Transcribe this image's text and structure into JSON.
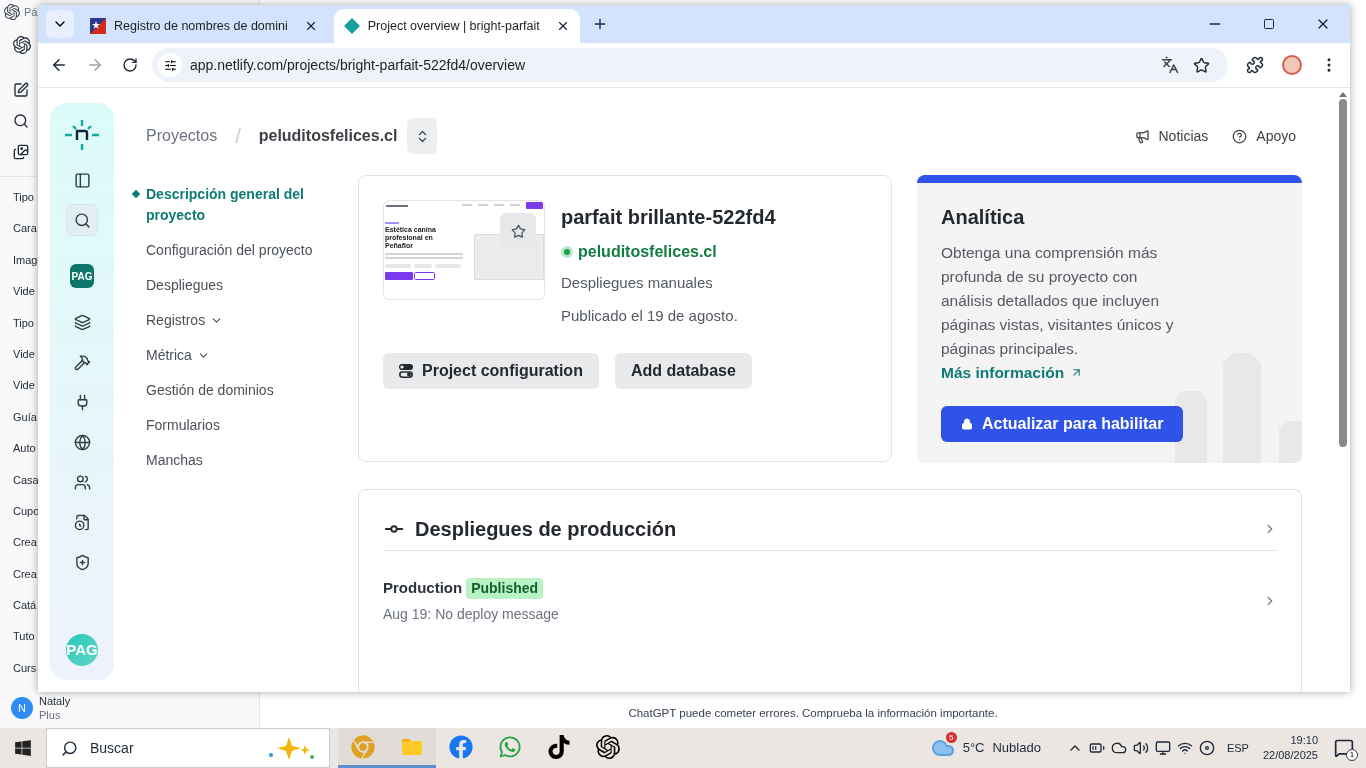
{
  "background_app": {
    "title_fragment": "Pá",
    "chats": [
      "Tipo",
      "Cara",
      "Imag",
      "Vide",
      "Tipo",
      "Vide",
      "Vide",
      "Guía",
      "Auto",
      "Casa",
      "Cupo",
      "Crea",
      "Crea",
      "Catá",
      "Tuto",
      "Curs"
    ],
    "user": {
      "initial": "N",
      "name": "Nataly",
      "plan": "Plus"
    },
    "disclaimer": "ChatGPT puede cometer errores. Comprueba la información importante."
  },
  "browser": {
    "tabs": [
      {
        "title": "Registro de nombres de domini",
        "selected": false,
        "kind": "flag"
      },
      {
        "title": "Project overview | bright-parfait",
        "selected": true,
        "kind": "diamond"
      }
    ],
    "url": "app.netlify.com/projects/bright-parfait-522fd4/overview"
  },
  "netlify": {
    "rail": [
      {
        "kind": "sidebar",
        "selected": false
      },
      {
        "kind": "search",
        "selected": true
      },
      {
        "kind": "team",
        "label": "PAG",
        "selected": false
      },
      {
        "kind": "layers",
        "selected": false
      },
      {
        "kind": "hammer",
        "selected": false
      },
      {
        "kind": "plug",
        "selected": false
      },
      {
        "kind": "globe",
        "selected": false
      },
      {
        "kind": "users",
        "selected": false
      },
      {
        "kind": "audit",
        "selected": false
      },
      {
        "kind": "shield",
        "selected": false
      }
    ],
    "avatar": "PAG",
    "breadcrumb": {
      "root": "Proyectos",
      "separator": "/",
      "current": "peluditosfelices.cl"
    },
    "header_links": [
      {
        "kind": "news",
        "label": "Noticias"
      },
      {
        "kind": "help",
        "label": "Apoyo"
      }
    ],
    "nav": [
      {
        "label": "Descripción general del proyecto",
        "selected": true,
        "expandable": false
      },
      {
        "label": "Configuración del proyecto",
        "selected": false,
        "expandable": false
      },
      {
        "label": "Despliegues",
        "selected": false,
        "expandable": false
      },
      {
        "label": "Registros",
        "selected": false,
        "expandable": true
      },
      {
        "label": "Métrica",
        "selected": false,
        "expandable": true
      },
      {
        "label": "Gestión de dominios",
        "selected": false,
        "expandable": false
      },
      {
        "label": "Formularios",
        "selected": false,
        "expandable": false
      },
      {
        "label": "Manchas",
        "selected": false,
        "expandable": false
      }
    ],
    "project": {
      "preview_heading": "Estética canina profesional en Peñaflor",
      "name": "parfait brillante-522fd4",
      "domain": "peluditosfelices.cl",
      "deploy_mode": "Despliegues manuales",
      "published": "Publicado el 19 de agosto.",
      "buttons": [
        {
          "kind": "config",
          "label": "Project configuration"
        },
        {
          "kind": "plain",
          "label": "Add database"
        }
      ]
    },
    "analytics": {
      "title": "Analítica",
      "description": "Obtenga una comprensión más profunda de su proyecto con análisis detallados que incluyen páginas vistas, visitantes únicos y páginas principales.",
      "link": "Más información",
      "button": "Actualizar para habilitar"
    },
    "production": {
      "title": "Despliegues de producción",
      "rows": [
        {
          "label": "Production",
          "badge": "Published",
          "message": "Aug 19: No deploy message"
        }
      ]
    }
  },
  "taskbar": {
    "search": "Buscar",
    "apps": [
      {
        "kind": "chrome",
        "active": true
      },
      {
        "kind": "files",
        "active": true
      },
      {
        "kind": "facebook",
        "active": false
      },
      {
        "kind": "whatsapp",
        "active": false
      },
      {
        "kind": "tiktok",
        "active": false
      },
      {
        "kind": "openai",
        "active": false
      }
    ],
    "weather": {
      "badge": "5",
      "temp": "5°C",
      "desc": "Nublado"
    },
    "lang": "ESP",
    "time": "19:10",
    "date": "22/08/2025",
    "notifications": "1"
  }
}
